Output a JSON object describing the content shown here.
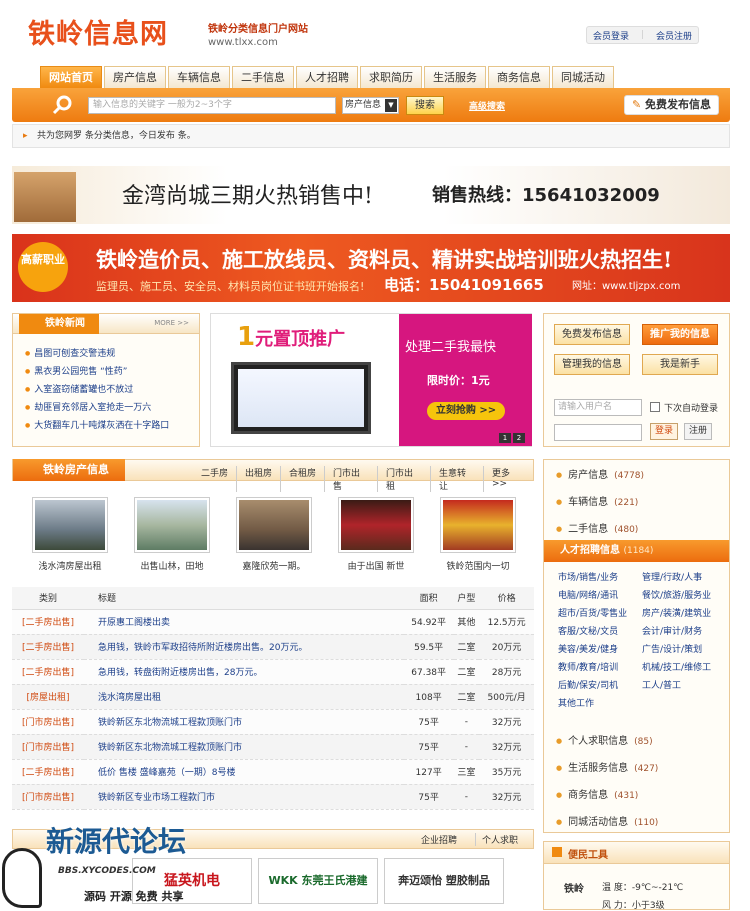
{
  "header": {
    "logo": "铁岭信息网",
    "slogan": "铁岭分类信息门户网站",
    "url": "www.tlxx.com",
    "login": "会员登录",
    "register": "会员注册"
  },
  "nav": [
    "网站首页",
    "房产信息",
    "车辆信息",
    "二手信息",
    "人才招聘",
    "求职简历",
    "生活服务",
    "商务信息",
    "同城活动"
  ],
  "search": {
    "placeholder": "输入信息的关键字 一般为2~3个字",
    "category": "房产信息",
    "button": "搜索",
    "advanced": "高级搜索",
    "post": "免费发布信息"
  },
  "notice": "共为您网罗 条分类信息，今日发布 条。",
  "banner1": {
    "title": "金湾尚城三期火热销售中!",
    "hotline": "销售热线：15641032009"
  },
  "banner2": {
    "badge": "高薪职业",
    "title": "铁岭造价员、施工放线员、资料员、精讲实战培训班火热招生!",
    "sub": "监理员、施工员、安全员、材料员岗位证书班开始报名!",
    "phone": "电话：15041091665",
    "site": "网址：www.tljzpx.com"
  },
  "news": {
    "title": "铁岭新闻",
    "more": "MORE >>",
    "items": [
      "昌图可刨查交警违规",
      "黑衣男公园兜售 “性药”",
      "入室盗窃储蓄罐也不放过",
      "劫匪冒充邻居入室抢走一万六",
      "大货翻车几十吨煤灰洒在十字路口"
    ]
  },
  "promo": {
    "left_a": "1",
    "left_b": "元置顶推广",
    "right": "处理二手我最快",
    "price": "限时价：1元",
    "buy": "立刻抢购 >>",
    "pages": [
      "1",
      "2"
    ]
  },
  "side": {
    "free": "免费发布信息",
    "promote": "推广我的信息",
    "manage": "管理我的信息",
    "newbie": "我是新手",
    "user_ph": "请输入用户名",
    "auto": "下次自动登录",
    "login": "登录",
    "reg": "注册"
  },
  "house": {
    "title": "铁岭房产信息",
    "tabs": [
      "二手房",
      "出租房",
      "合租房",
      "门市出售",
      "门市出租",
      "生意转让",
      "更多>>"
    ],
    "thumbs": [
      "浅水湾房屋出租",
      "出售山林，田地",
      "嘉隆欣苑一期。",
      "由于出国 新世",
      "铁岭范围内一切"
    ],
    "cols": [
      "类别",
      "标题",
      "面积",
      "户型",
      "价格"
    ],
    "rows": [
      [
        "[二手房出售]",
        "开原惠工阁楼出卖",
        "54.92平",
        "其他",
        "12.5万元"
      ],
      [
        "[二手房出售]",
        "急用钱，铁岭市军政招待所附近楼房出售。20万元。",
        "59.5平",
        "二室",
        "20万元"
      ],
      [
        "[二手房出售]",
        "急用钱，转盘街附近楼房出售，28万元。",
        "67.38平",
        "二室",
        "28万元"
      ],
      [
        "[房屋出租]",
        "浅水湾房屋出租",
        "108平",
        "二室",
        "500元/月"
      ],
      [
        "[门市房出售]",
        "铁岭新区东北物流城工程款顶账门市",
        "75平",
        "-",
        "32万元"
      ],
      [
        "[门市房出售]",
        "铁岭新区东北物流城工程款顶账门市",
        "75平",
        "-",
        "32万元"
      ],
      [
        "[二手房出售]",
        "低价 售楼 盛峰嘉苑（一期）8号楼",
        "127平",
        "三室",
        "35万元"
      ],
      [
        "[门市房出售]",
        "铁岭新区专业市场工程款门市",
        "75平",
        "-",
        "32万元"
      ]
    ]
  },
  "cats": {
    "top": [
      [
        "房产信息",
        "(4778)"
      ],
      [
        "车辆信息",
        "(221)"
      ],
      [
        "二手信息",
        "(480)"
      ]
    ],
    "job": {
      "title": "人才招聘信息",
      "count": "(1184)",
      "items": [
        "市场/销售/业务",
        "管理/行政/人事",
        "电脑/网络/通讯",
        "餐饮/旅游/服务业",
        "超市/百货/零售业",
        "房产/装潢/建筑业",
        "客服/文秘/文员",
        "会计/审计/财务",
        "美容/美发/健身",
        "广告/设计/策划",
        "教师/教育/培训",
        "机械/技工/维修工",
        "后勤/保安/司机",
        "工人/普工",
        "其他工作"
      ]
    },
    "bottom": [
      [
        "个人求职信息",
        "(85)"
      ],
      [
        "生活服务信息",
        "(427)"
      ],
      [
        "商务信息",
        "(431)"
      ],
      [
        "同城活动信息",
        "(110)"
      ]
    ]
  },
  "tools": {
    "title": "便民工具",
    "city": "铁岭",
    "temp": "温 度：-9℃~-21℃",
    "wind": "风 力：小于3级"
  },
  "bottom": {
    "tabs": [
      "企业招聘",
      "个人求职"
    ],
    "logos": [
      "猛英机电",
      "WKK 东莞王氏港建",
      "奔迈颂怡 塑胶制品"
    ]
  },
  "watermark": {
    "main": "新源代论坛",
    "sub": "BBS.XYCODES.COM",
    "tag": "源码 开源 免费 共享"
  }
}
